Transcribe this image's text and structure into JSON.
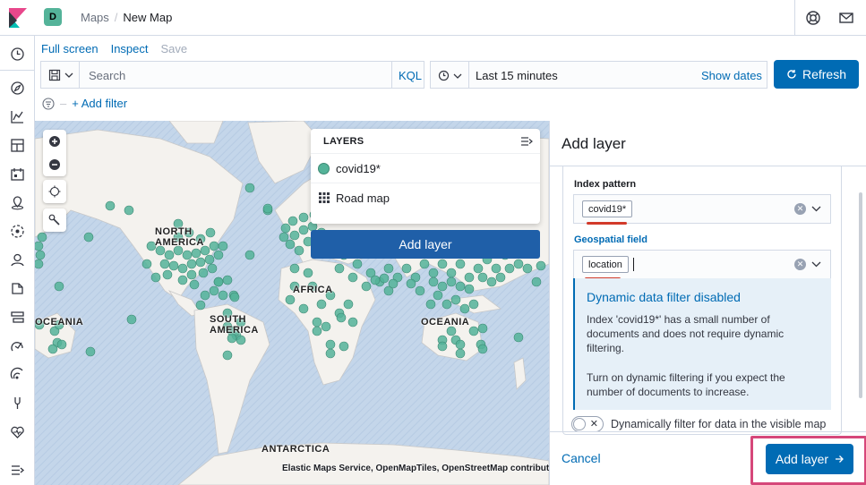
{
  "header": {
    "space_initial": "D",
    "breadcrumbs": [
      "Maps",
      "New Map"
    ],
    "separator": "/"
  },
  "app_menu": {
    "full_screen": "Full screen",
    "inspect": "Inspect",
    "save": "Save"
  },
  "query": {
    "search_placeholder": "Search",
    "language": "KQL",
    "time_range": "Last 15 minutes",
    "show_dates": "Show dates",
    "refresh": "Refresh"
  },
  "filters": {
    "add_filter": "+ Add filter"
  },
  "map": {
    "labels": {
      "north_america": "NORTH AMERICA",
      "south_america": "SOUTH AMERICA",
      "africa": "AFRICA",
      "oceania_left": "OCEANIA",
      "oceania_right": "OCEANIA",
      "antarctica": "ANTARCTICA"
    },
    "north_line1": "NORTH",
    "north_line2": "AMERICA",
    "south_line1": "SOUTH",
    "south_line2": "AMERICA",
    "attribution": "Elastic Maps Service, OpenMapTiles, OpenStreetMap contributors",
    "point_color": "#54b399"
  },
  "layers": {
    "title": "LAYERS",
    "items": [
      {
        "name": "covid19*"
      },
      {
        "name": "Road map"
      }
    ],
    "add_layer": "Add layer"
  },
  "flyout": {
    "title": "Add layer",
    "index_pattern_label": "Index pattern",
    "index_pattern_value": "covid19*",
    "geo_field_label": "Geospatial field",
    "geo_field_value": "location",
    "callout_title": "Dynamic data filter disabled",
    "callout_p1": "Index 'covid19*' has a small number of documents and does not require dynamic filtering.",
    "callout_p2": "Turn on dynamic filtering if you expect the number of documents to increase.",
    "toggle_label": "Dynamically filter for data in the visible map",
    "cancel": "Cancel",
    "add_layer": "Add layer"
  },
  "colors": {
    "accent": "#006bb4",
    "highlight": "#d6477a",
    "underline": "#d23a2a"
  }
}
